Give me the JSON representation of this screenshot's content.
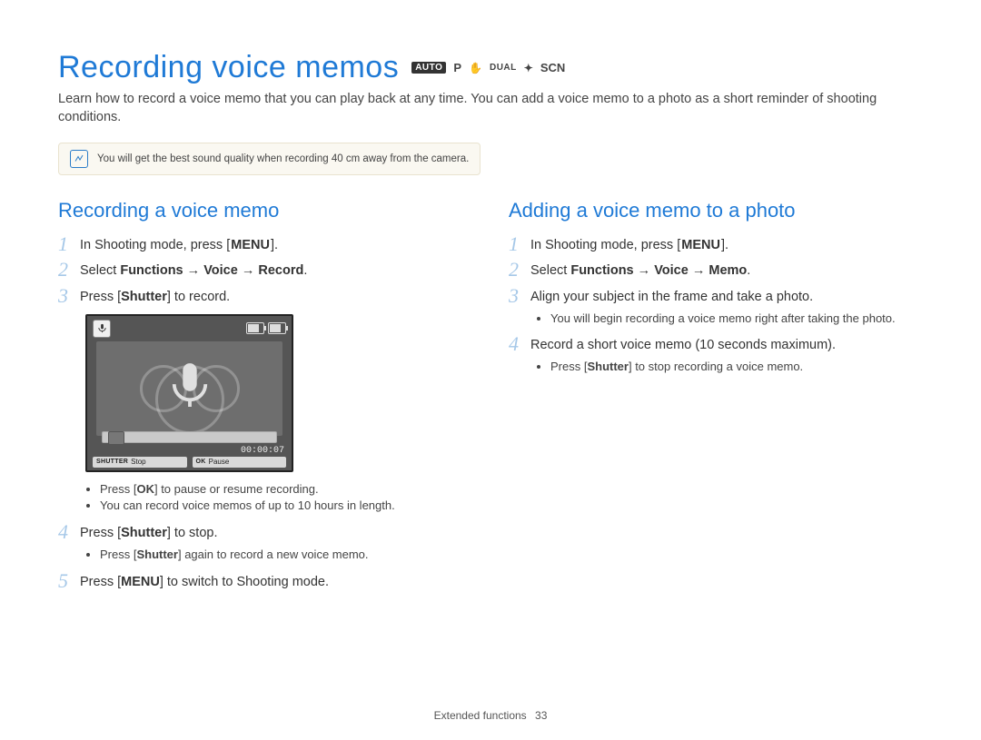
{
  "title": "Recording voice memos",
  "modes": {
    "auto": "AUTO",
    "p": "P",
    "dual": "DUAL",
    "scn": "SCN"
  },
  "intro": "Learn how to record a voice memo that you can play back at any time. You can add a voice memo to a photo as a short reminder of shooting conditions.",
  "tip": "You will get the best sound quality when recording 40 cm away from the camera.",
  "left": {
    "heading": "Recording a voice memo",
    "s1_pre": "In Shooting mode, press [",
    "s1_key": "MENU",
    "s1_post": "].",
    "s2_pre": "Select ",
    "s2_b1": "Functions",
    "s2_arrow1": " → ",
    "s2_b2": "Voice",
    "s2_arrow2": " → ",
    "s2_b3": "Record",
    "s2_post": ".",
    "s3_pre": "Press [",
    "s3_key": "Shutter",
    "s3_post": "] to record.",
    "cam": {
      "time": "00:00:07",
      "btn1_label": "SHUTTER",
      "btn1_text": "Stop",
      "btn2_label": "OK",
      "btn2_text": "Pause"
    },
    "b1_pre": "Press [",
    "b1_key": "OK",
    "b1_post": "] to pause or resume recording.",
    "b2": "You can record voice memos of up to 10 hours in length.",
    "s4_pre": "Press [",
    "s4_key": "Shutter",
    "s4_post": "] to stop.",
    "b3_pre": "Press [",
    "b3_key": "Shutter",
    "b3_post": "] again to record a new voice memo.",
    "s5_pre": "Press [",
    "s5_key": "MENU",
    "s5_post": "] to switch to Shooting mode."
  },
  "right": {
    "heading": "Adding a voice memo to a photo",
    "s1_pre": "In Shooting mode, press [",
    "s1_key": "MENU",
    "s1_post": "].",
    "s2_pre": "Select ",
    "s2_b1": "Functions",
    "s2_arrow1": " → ",
    "s2_b2": "Voice",
    "s2_arrow2": " → ",
    "s2_b3": "Memo",
    "s2_post": ".",
    "s3": "Align your subject in the frame and take a photo.",
    "b1": "You will begin recording a voice memo right after taking the photo.",
    "s4": "Record a short voice memo (10 seconds maximum).",
    "b2_pre": "Press [",
    "b2_key": "Shutter",
    "b2_post": "] to stop recording a voice memo."
  },
  "nums": {
    "n1": "1",
    "n2": "2",
    "n3": "3",
    "n4": "4",
    "n5": "5"
  },
  "footer_section": "Extended functions",
  "footer_page": "33"
}
